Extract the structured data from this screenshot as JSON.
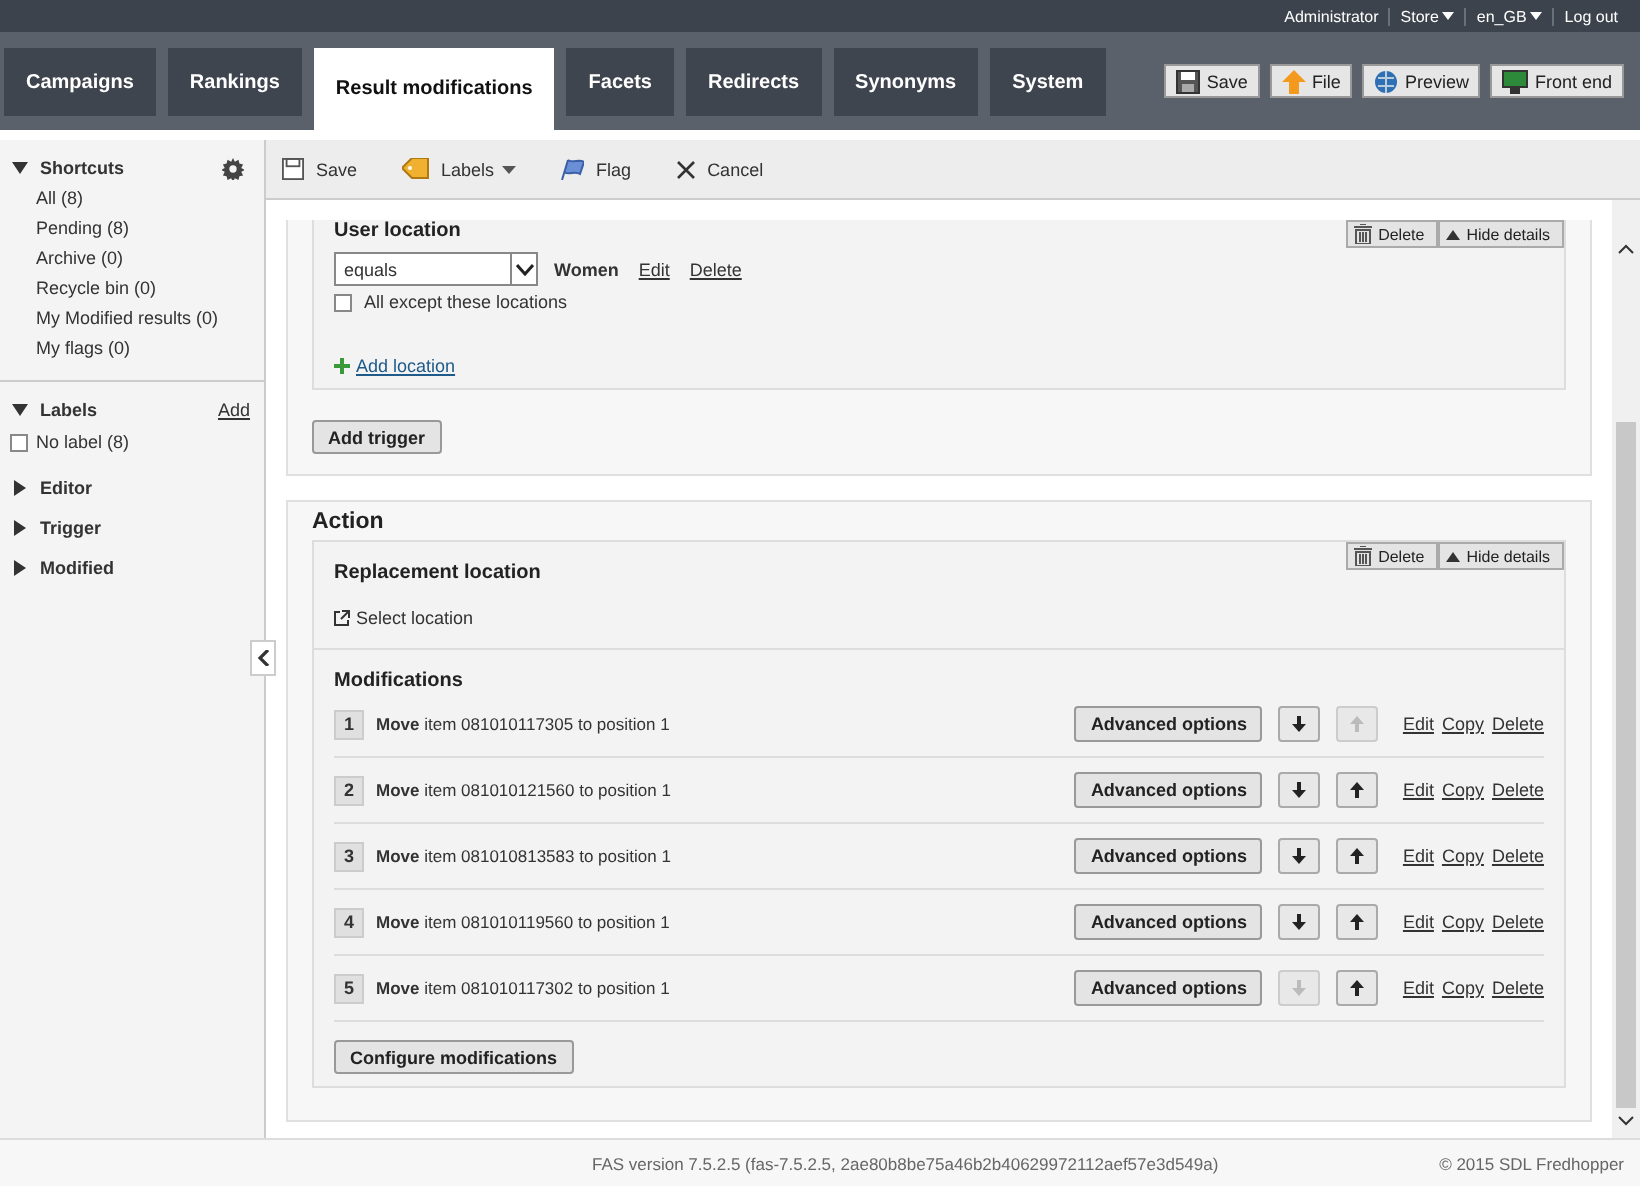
{
  "top_bar": [
    {
      "label": "Administrator",
      "dropdown": false
    },
    {
      "label": "Store",
      "dropdown": true
    },
    {
      "label": "en_GB",
      "dropdown": true
    },
    {
      "label": "Log out",
      "dropdown": false
    }
  ],
  "tabs": [
    {
      "label": "Campaigns",
      "selected": false
    },
    {
      "label": "Rankings",
      "selected": false
    },
    {
      "label": "Result modifications",
      "selected": true
    },
    {
      "label": "Facets",
      "selected": false
    },
    {
      "label": "Redirects",
      "selected": false
    },
    {
      "label": "Synonyms",
      "selected": false
    },
    {
      "label": "System",
      "selected": false
    }
  ],
  "header_buttons": [
    {
      "label": "Save",
      "kind": "save"
    },
    {
      "label": "File",
      "kind": "file"
    },
    {
      "label": "Preview",
      "kind": "preview"
    },
    {
      "label": "Front end",
      "kind": "frontend"
    }
  ],
  "sidebar": {
    "shortcuts": {
      "title": "Shortcuts",
      "expanded": true,
      "items": [
        "All (8)",
        "Pending (8)",
        "Archive (0)",
        "Recycle bin (0)",
        "My Modified results (0)",
        "My flags (0)"
      ]
    },
    "labels": {
      "title": "Labels",
      "expanded": true,
      "add": "Add",
      "items": [
        {
          "label": "No label (8)",
          "checked": false
        }
      ]
    },
    "groups": [
      {
        "label": "Editor",
        "expanded": false
      },
      {
        "label": "Trigger",
        "expanded": false
      },
      {
        "label": "Modified",
        "expanded": false
      }
    ]
  },
  "toolbar": [
    {
      "label": "Save",
      "kind": "save"
    },
    {
      "label": "Labels",
      "kind": "labels"
    },
    {
      "label": "Flag",
      "kind": "flag"
    },
    {
      "label": "Cancel",
      "kind": "cancel"
    }
  ],
  "trigger": {
    "delete": "Delete",
    "hide_details": "Hide details",
    "title": "User location",
    "operator": "equals",
    "value": "Women",
    "edit": "Edit",
    "remove": "Delete",
    "except": {
      "label": "All except these locations",
      "checked": false
    },
    "add_location": "Add location",
    "add_trigger": "Add trigger"
  },
  "action": {
    "title": "Action",
    "replacement": {
      "title": "Replacement location",
      "delete": "Delete",
      "hide_details": "Hide details",
      "select_location": "Select location"
    },
    "modifications": {
      "title": "Modifications",
      "configure": "Configure modifications",
      "rows": [
        {
          "number": "1",
          "text": "**Move** item 081010117305 to position 1",
          "advanced": "Advanced options",
          "down_disabled": false,
          "up_disabled": true,
          "edit": "Edit",
          "copy": "Copy",
          "delete": "Delete"
        },
        {
          "number": "2",
          "text": "**Move** item 081010121560 to position 1",
          "advanced": "Advanced options",
          "down_disabled": false,
          "up_disabled": false,
          "edit": "Edit",
          "copy": "Copy",
          "delete": "Delete"
        },
        {
          "number": "3",
          "text": "**Move** item 081010813583 to position 1",
          "advanced": "Advanced options",
          "down_disabled": false,
          "up_disabled": false,
          "edit": "Edit",
          "copy": "Copy",
          "delete": "Delete"
        },
        {
          "number": "4",
          "text": "**Move** item 081010119560 to position 1",
          "advanced": "Advanced options",
          "down_disabled": false,
          "up_disabled": false,
          "edit": "Edit",
          "copy": "Copy",
          "delete": "Delete"
        },
        {
          "number": "5",
          "text": "**Move** item 081010117302 to position 1",
          "advanced": "Advanced options",
          "down_disabled": true,
          "up_disabled": false,
          "edit": "Edit",
          "copy": "Copy",
          "delete": "Delete"
        }
      ]
    }
  },
  "footer": {
    "version": "FAS version 7.5.2.5 (fas-7.5.2.5, 2ae80b8be75a46b2b40629972112aef57e3d549a)",
    "copyright": "© 2015 SDL Fredhopper"
  }
}
